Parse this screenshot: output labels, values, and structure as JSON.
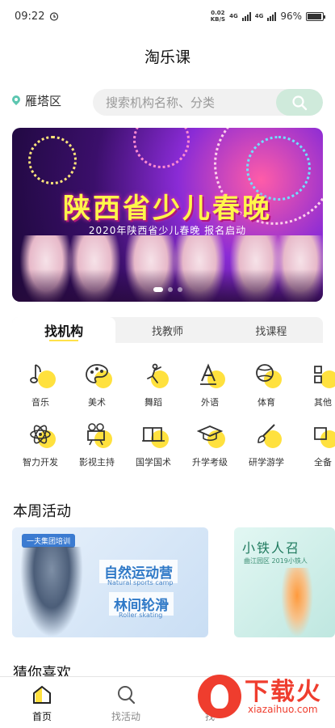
{
  "status_bar": {
    "time": "09:22",
    "net_speed": "0.02",
    "net_unit": "KB/S",
    "signal1": "4G",
    "signal2": "4G",
    "battery": "96%"
  },
  "header": {
    "title": "淘乐课"
  },
  "search": {
    "location": "雁塔区",
    "placeholder": "搜索机构名称、分类"
  },
  "banner": {
    "title": "陕西省少儿春晚",
    "subtitle": "2020年陕西省少儿春晚 报名启动"
  },
  "tabs": [
    {
      "label": "找机构"
    },
    {
      "label": "找教师"
    },
    {
      "label": "找课程"
    }
  ],
  "categories_row1": [
    {
      "label": "音乐",
      "icon": "music-icon"
    },
    {
      "label": "美术",
      "icon": "palette-icon"
    },
    {
      "label": "舞蹈",
      "icon": "dance-icon"
    },
    {
      "label": "外语",
      "icon": "letter-a-icon"
    },
    {
      "label": "体育",
      "icon": "ball-icon"
    },
    {
      "label": "其他",
      "icon": "more-icon"
    }
  ],
  "categories_row2": [
    {
      "label": "智力开发",
      "icon": "atom-icon"
    },
    {
      "label": "影视主持",
      "icon": "camera-icon"
    },
    {
      "label": "国学国术",
      "icon": "book-icon"
    },
    {
      "label": "升学考级",
      "icon": "graduation-cap-icon"
    },
    {
      "label": "研学游学",
      "icon": "brush-icon"
    },
    {
      "label": "全备",
      "icon": "more-icon"
    }
  ],
  "weekly": {
    "title": "本周活动"
  },
  "activities": [
    {
      "logo": "一夫集团培训",
      "heading1": "自然运动营",
      "en1": "Natural sports camp",
      "heading2": "林间轮滑",
      "en2": "Roller skating"
    },
    {
      "heading": "小铁人召",
      "sub": "曲江园区 2019小铁人"
    }
  ],
  "guess": {
    "title": "猜你喜欢"
  },
  "tabbar": [
    {
      "label": "首页"
    },
    {
      "label": "找活动"
    },
    {
      "label": "找"
    }
  ],
  "watermark": {
    "text": "下载火",
    "url": "xiazaihuo.com"
  },
  "colors": {
    "accent_yellow": "#ffe13e",
    "search_button": "#cfeadb",
    "pin": "#5cc6b0",
    "watermark_red": "#ef3d2e"
  }
}
